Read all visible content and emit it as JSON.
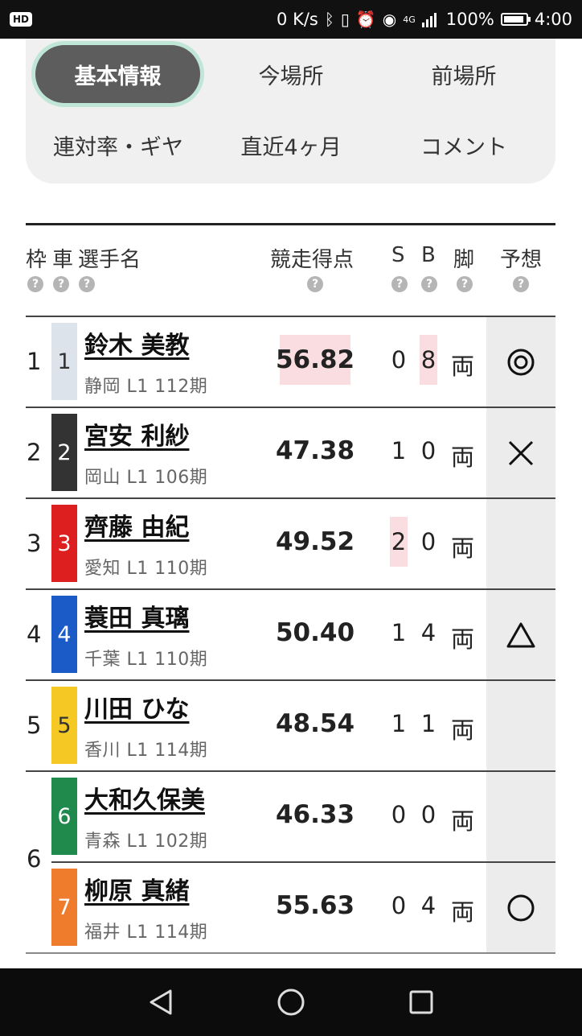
{
  "status_bar": {
    "hd": "HD",
    "network_speed": "0 K/s",
    "signal_label": "4G",
    "battery": "100%",
    "time": "4:00"
  },
  "tabs": [
    {
      "label": "基本情報",
      "active": true
    },
    {
      "label": "今場所",
      "active": false
    },
    {
      "label": "前場所",
      "active": false
    },
    {
      "label": "連対率・ギヤ",
      "active": false
    },
    {
      "label": "直近4ヶ月",
      "active": false
    },
    {
      "label": "コメント",
      "active": false
    }
  ],
  "table": {
    "headers": {
      "frame": "枠",
      "car": "車",
      "name": "選手名",
      "score": "競走得点",
      "s": "S",
      "b": "B",
      "leg": "脚",
      "prediction": "予想"
    },
    "help_glyph": "?",
    "rows": [
      {
        "frame": "1",
        "car": "1",
        "car_color": "#dde3ea",
        "car_text_color": "#333333",
        "name": "鈴木 美教",
        "info": "静岡 L1 112期",
        "score": "56.82",
        "score_highlight": true,
        "s": "0",
        "s_highlight": false,
        "b": "8",
        "b_highlight": true,
        "leg": "両",
        "prediction": "double-circle"
      },
      {
        "frame": "2",
        "car": "2",
        "car_color": "#333333",
        "car_text_color": "#ffffff",
        "name": "宮安 利紗",
        "info": "岡山 L1 106期",
        "score": "47.38",
        "score_highlight": false,
        "s": "1",
        "s_highlight": false,
        "b": "0",
        "b_highlight": false,
        "leg": "両",
        "prediction": "cross"
      },
      {
        "frame": "3",
        "car": "3",
        "car_color": "#dd1f1f",
        "car_text_color": "#ffffff",
        "name": "齊藤 由紀",
        "info": "愛知 L1 110期",
        "score": "49.52",
        "score_highlight": false,
        "s": "2",
        "s_highlight": true,
        "b": "0",
        "b_highlight": false,
        "leg": "両",
        "prediction": "none"
      },
      {
        "frame": "4",
        "car": "4",
        "car_color": "#1a5bc8",
        "car_text_color": "#ffffff",
        "name": "蓑田 真璃",
        "info": "千葉 L1 110期",
        "score": "50.40",
        "score_highlight": false,
        "s": "1",
        "s_highlight": false,
        "b": "4",
        "b_highlight": false,
        "leg": "両",
        "prediction": "triangle"
      },
      {
        "frame": "5",
        "car": "5",
        "car_color": "#f5c824",
        "car_text_color": "#333333",
        "name": "川田 ひな",
        "info": "香川 L1 114期",
        "score": "48.54",
        "score_highlight": false,
        "s": "1",
        "s_highlight": false,
        "b": "1",
        "b_highlight": false,
        "leg": "両",
        "prediction": "none"
      },
      {
        "frame": "",
        "car": "6",
        "car_color": "#1f8a4c",
        "car_text_color": "#ffffff",
        "name": "大和久保美",
        "info": "青森 L1 102期",
        "score": "46.33",
        "score_highlight": false,
        "s": "0",
        "s_highlight": false,
        "b": "0",
        "b_highlight": false,
        "leg": "両",
        "prediction": "none"
      },
      {
        "frame": "",
        "car": "7",
        "car_color": "#ef7b2d",
        "car_text_color": "#ffffff",
        "name": "柳原 真緒",
        "info": "福井 L1 114期",
        "score": "55.63",
        "score_highlight": false,
        "s": "0",
        "s_highlight": false,
        "b": "4",
        "b_highlight": false,
        "leg": "両",
        "prediction": "circle"
      }
    ],
    "merged_frame": "6"
  },
  "colors": {
    "active_tab": "#5d5d5d",
    "active_tab_ring": "#bfe6d7",
    "highlight": "#fadde0"
  }
}
